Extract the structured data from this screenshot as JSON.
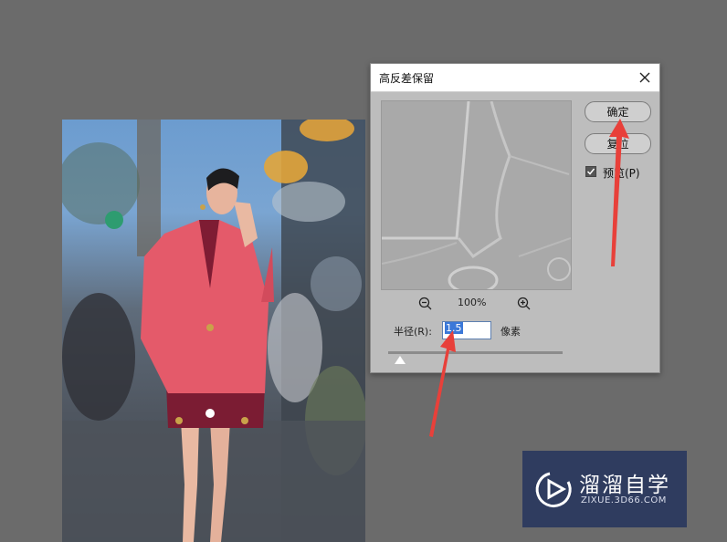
{
  "dialog": {
    "title": "高反差保留",
    "ok_label": "确定",
    "reset_label": "复位",
    "preview_label": "预览(P)",
    "preview_checked": true,
    "zoom_level": "100%",
    "radius_label": "半径(R):",
    "radius_value": "1.5",
    "unit_label": "像素"
  },
  "watermark": {
    "title": "溜溜自学",
    "subtitle": "ZIXUE.3D66.COM"
  },
  "colors": {
    "workspace_bg": "#6b6b6b",
    "dialog_bg": "#bdbdbd",
    "arrow": "#e8403a",
    "watermark_bg": "#2f3c5f",
    "selection": "#3b78d8"
  },
  "icons": [
    "close-icon",
    "zoom-out-icon",
    "zoom-in-icon",
    "checkmark-icon",
    "play-logo-icon"
  ]
}
